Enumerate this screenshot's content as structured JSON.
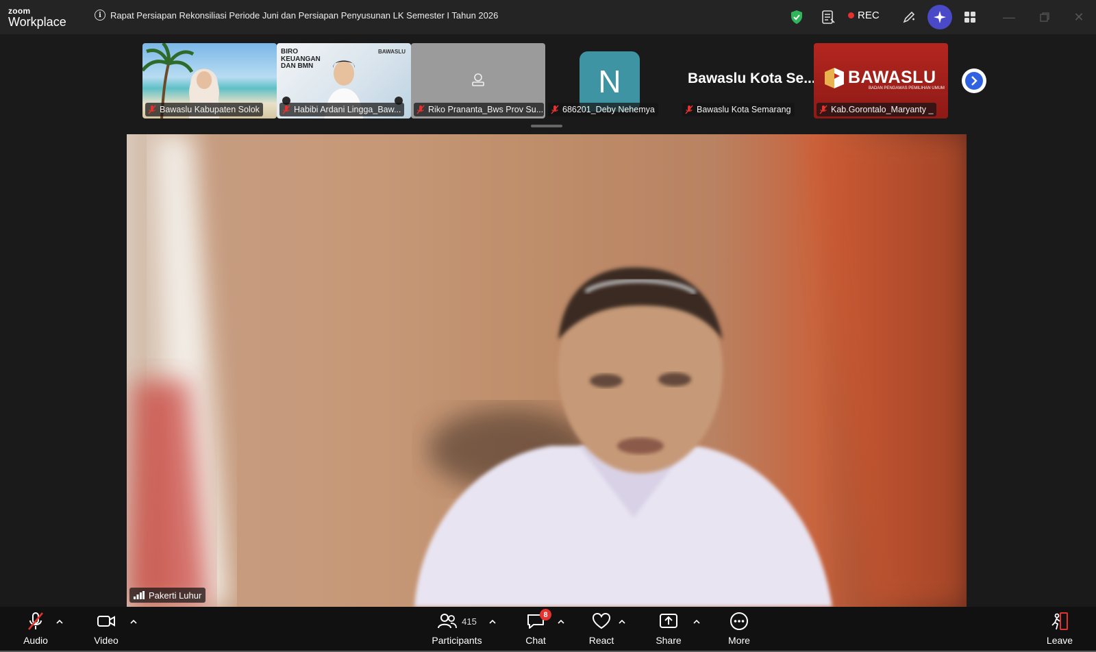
{
  "app": {
    "logo_top": "zoom",
    "logo_bottom": "Workplace"
  },
  "meeting": {
    "title": "Rapat Persiapan Rekonsiliasi Periode Juni dan Persiapan Penyusunan LK Semester I Tahun 2026"
  },
  "titlebar": {
    "rec_label": "REC"
  },
  "gallery": {
    "tiles": [
      {
        "name": "Bawaslu Kabupaten Solok"
      },
      {
        "name": "Habibi Ardani Lingga_Baw...",
        "poster_text": "BIRO KEUANGAN DAN BMN",
        "brand": "BAWASLU"
      },
      {
        "name": "Riko Prananta_Bws Prov Su..."
      },
      {
        "name": "686201_Deby Nehemya",
        "avatar_letter": "N"
      },
      {
        "name": "Bawaslu Kota Semarang",
        "display": "Bawaslu Kota Se..."
      },
      {
        "name": "Kab.Gorontalo_Maryanty _",
        "brand": "BAWASLU",
        "brand_sub": "BADAN PENGAWAS PEMILIHAN UMUM"
      }
    ]
  },
  "main": {
    "speaker": "Pakerti Luhur"
  },
  "toolbar": {
    "audio": "Audio",
    "video": "Video",
    "participants": "Participants",
    "participants_count": "415",
    "chat": "Chat",
    "chat_badge": "8",
    "react": "React",
    "share": "Share",
    "more": "More",
    "leave": "Leave"
  },
  "colors": {
    "accent": "#4a4ac8",
    "rec": "#e5322f",
    "shield": "#2fb55a",
    "leave": "#e5322f"
  }
}
